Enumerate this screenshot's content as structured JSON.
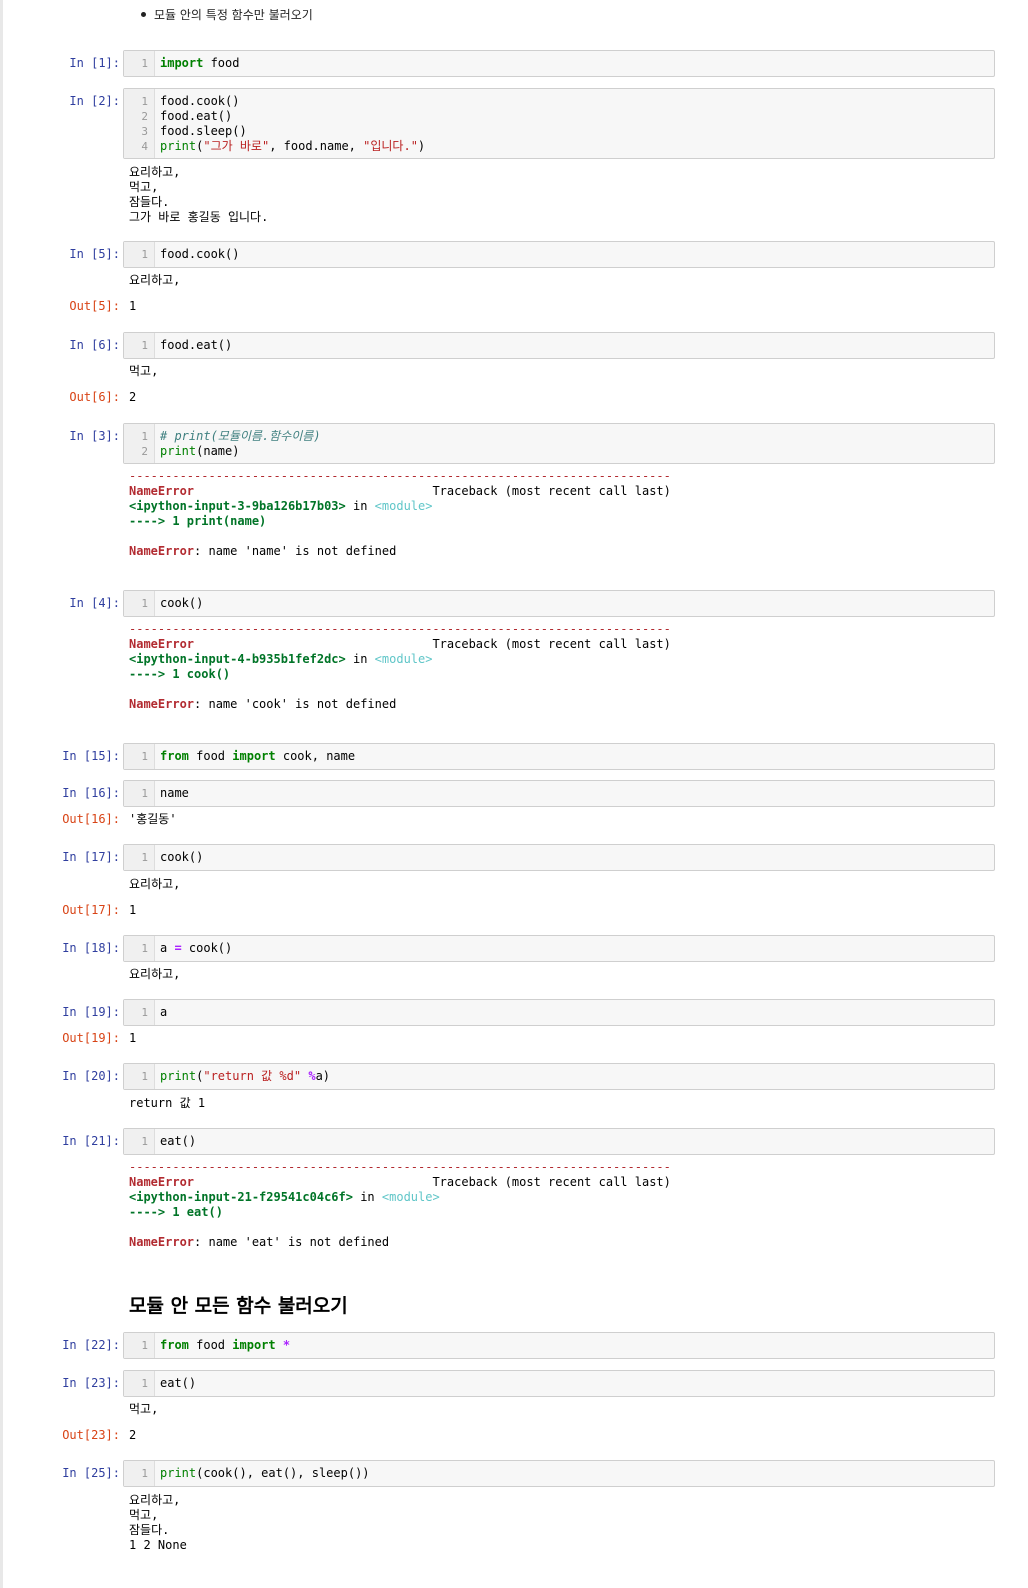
{
  "bullet": "모듈 안의 특정 함수만 불러오기",
  "heading2": "모듈 안 모든 함수 불러오기",
  "cells": [
    {
      "in": "In [1]:",
      "lines": [
        "import food"
      ]
    },
    {
      "in": "In [2]:",
      "lines": [
        "food.cook()",
        "food.eat()",
        "food.sleep()",
        "print(\"그가 바로\", food.name, \"입니다.\")"
      ],
      "stdout": "요리하고,\n먹고,\n잠들다.\n그가 바로 홍길동 입니다."
    },
    {
      "in": "In [5]:",
      "lines": [
        "food.cook()"
      ],
      "stdout": "요리하고,",
      "out": "Out[5]:",
      "result": "1"
    },
    {
      "in": "In [6]:",
      "lines": [
        "food.eat()"
      ],
      "stdout": "먹고,",
      "out": "Out[6]:",
      "result": "2"
    },
    {
      "in": "In [3]:",
      "lines": [
        "# print(모듈이름.함수이름)",
        "print(name)"
      ],
      "error": {
        "dashes": "---------------------------------------------------------------------------",
        "name": "NameError",
        "traceback": "Traceback (most recent call last)",
        "input": "<ipython-input-3-9ba126b17b03>",
        "in": "in",
        "module": "<module>",
        "arrow": "----> 1 print(name)",
        "message": ": name 'name' is not defined"
      }
    },
    {
      "in": "In [4]:",
      "lines": [
        "cook()"
      ],
      "error": {
        "dashes": "---------------------------------------------------------------------------",
        "name": "NameError",
        "traceback": "Traceback (most recent call last)",
        "input": "<ipython-input-4-b935b1fef2dc>",
        "in": "in",
        "module": "<module>",
        "arrow": "----> 1 cook()",
        "message": ": name 'cook' is not defined"
      }
    },
    {
      "in": "In [15]:",
      "lines": [
        "from food import cook, name"
      ]
    },
    {
      "in": "In [16]:",
      "lines": [
        "name"
      ],
      "out": "Out[16]:",
      "result": "'홍길동'"
    },
    {
      "in": "In [17]:",
      "lines": [
        "cook()"
      ],
      "stdout": "요리하고,",
      "out": "Out[17]:",
      "result": "1"
    },
    {
      "in": "In [18]:",
      "lines": [
        "a = cook()"
      ],
      "stdout": "요리하고,"
    },
    {
      "in": "In [19]:",
      "lines": [
        "a"
      ],
      "out": "Out[19]:",
      "result": "1"
    },
    {
      "in": "In [20]:",
      "lines": [
        "print(\"return 값 %d\" %a)"
      ],
      "stdout": "return 값 1"
    },
    {
      "in": "In [21]:",
      "lines": [
        "eat()"
      ],
      "error": {
        "dashes": "---------------------------------------------------------------------------",
        "name": "NameError",
        "traceback": "Traceback (most recent call last)",
        "input": "<ipython-input-21-f29541c04c6f>",
        "in": "in",
        "module": "<module>",
        "arrow": "----> 1 eat()",
        "message": ": name 'eat' is not defined"
      }
    },
    {
      "in": "In [22]:",
      "lines": [
        "from food import *"
      ]
    },
    {
      "in": "In [23]:",
      "lines": [
        "eat()"
      ],
      "stdout": "먹고,",
      "out": "Out[23]:",
      "result": "2"
    },
    {
      "in": "In [25]:",
      "lines": [
        "print(cook(), eat(), sleep())"
      ],
      "stdout": "요리하고,\n먹고,\n잠들다.\n1 2 None"
    }
  ]
}
